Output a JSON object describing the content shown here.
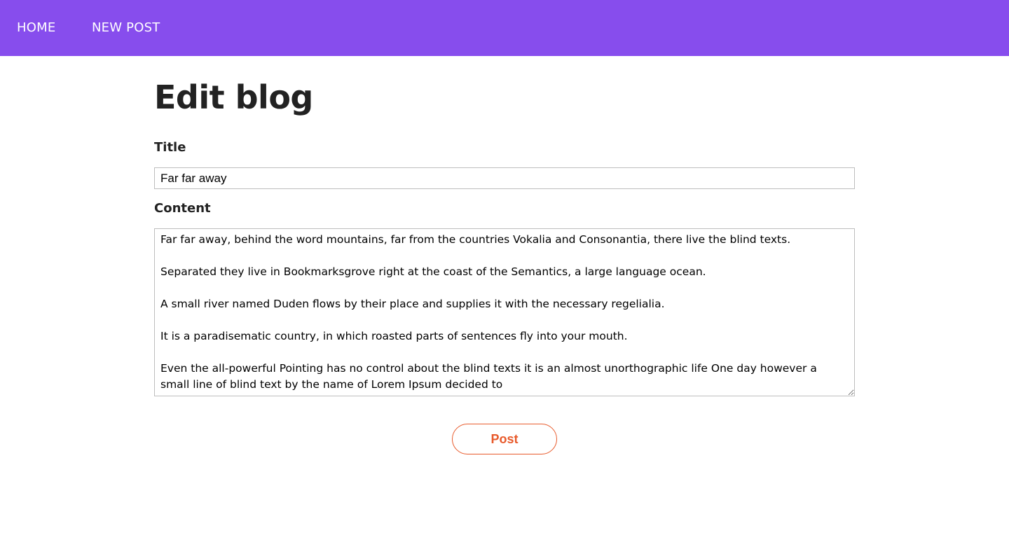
{
  "nav": {
    "home_label": "HOME",
    "new_post_label": "NEW POST"
  },
  "page": {
    "title": "Edit blog"
  },
  "form": {
    "title_label": "Title",
    "title_value": "Far far away",
    "content_label": "Content",
    "content_value": "Far far away, behind the word mountains, far from the countries Vokalia and Consonantia, there live the blind texts.\n\nSeparated they live in Bookmarksgrove right at the coast of the Semantics, a large language ocean.\n\nA small river named Duden flows by their place and supplies it with the necessary regelialia.\n\nIt is a paradisematic country, in which roasted parts of sentences fly into your mouth.\n\nEven the all-powerful Pointing has no control about the blind texts it is an almost unorthographic life One day however a small line of blind text by the name of Lorem Ipsum decided to",
    "submit_label": "Post"
  },
  "colors": {
    "navbar_bg": "#874ded",
    "accent": "#e85a2b"
  }
}
